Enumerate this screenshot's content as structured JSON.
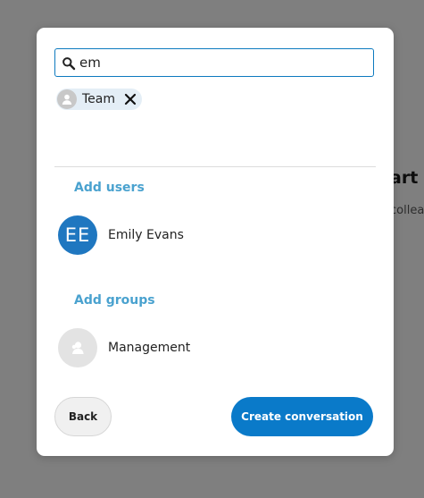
{
  "background": {
    "title_fragment": "art",
    "subtitle_fragment": "collea"
  },
  "dialog": {
    "search": {
      "value": "em",
      "icon": "search-icon"
    },
    "selected": [
      {
        "label": "Team",
        "icon": "group-icon",
        "remove_icon": "close-icon"
      }
    ],
    "users_heading": "Add users",
    "users": [
      {
        "initials": "EE",
        "name": "Emily Evans"
      }
    ],
    "groups_heading": "Add groups",
    "groups": [
      {
        "name": "Management",
        "icon": "group-icon"
      }
    ],
    "back_label": "Back",
    "create_label": "Create conversation"
  },
  "colors": {
    "accent": "#0a7ac9",
    "heading": "#4aa2cf",
    "avatar": "#1f77c0",
    "chip_bg": "#e4eef6"
  }
}
